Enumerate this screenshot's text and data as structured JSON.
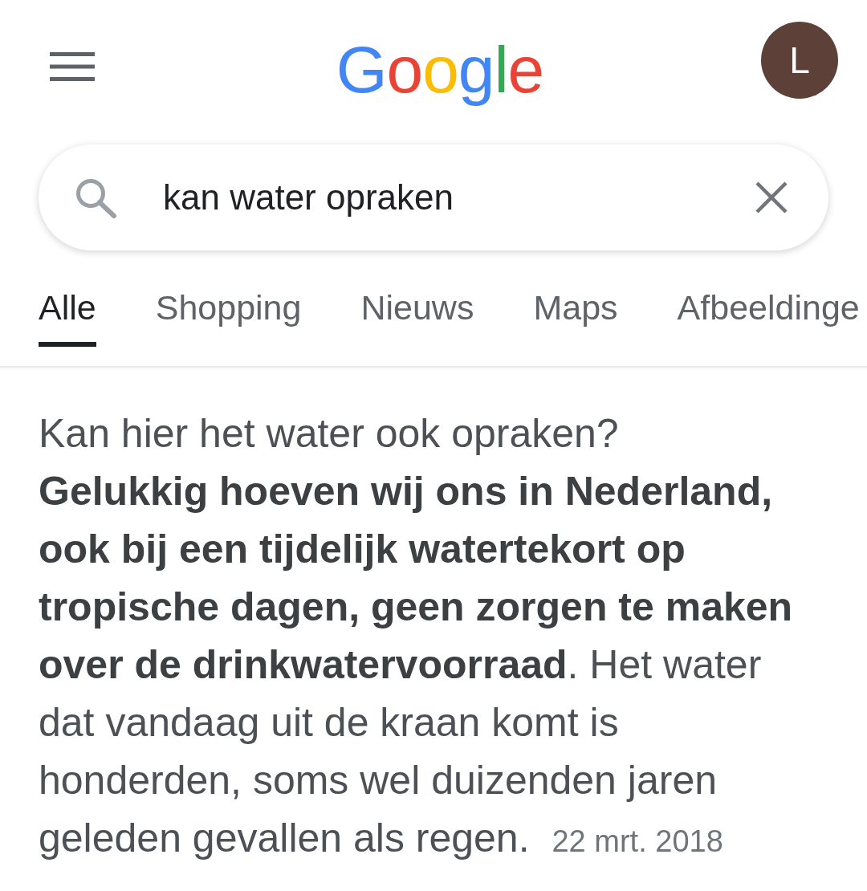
{
  "header": {
    "logo": "Google",
    "avatar_letter": "L"
  },
  "search": {
    "value": "kan water opraken"
  },
  "tabs": [
    {
      "label": "Alle",
      "selected": true
    },
    {
      "label": "Shopping",
      "selected": false
    },
    {
      "label": "Nieuws",
      "selected": false
    },
    {
      "label": "Maps",
      "selected": false
    },
    {
      "label": "Afbeeldinge",
      "selected": false
    }
  ],
  "answer": {
    "question": "Kan hier het water ook opraken?",
    "text": "**Gelukkig hoeven wij ons in Nederland, ook bij een tijdelijk watertekort op tropische dagen, geen zorgen te maken over de drinkwatervoorraad**. Het water dat vandaag uit de kraan komt is honderden, soms wel duizenden jaren geleden gevallen als regen.",
    "date": "22 mrt. 2018"
  }
}
